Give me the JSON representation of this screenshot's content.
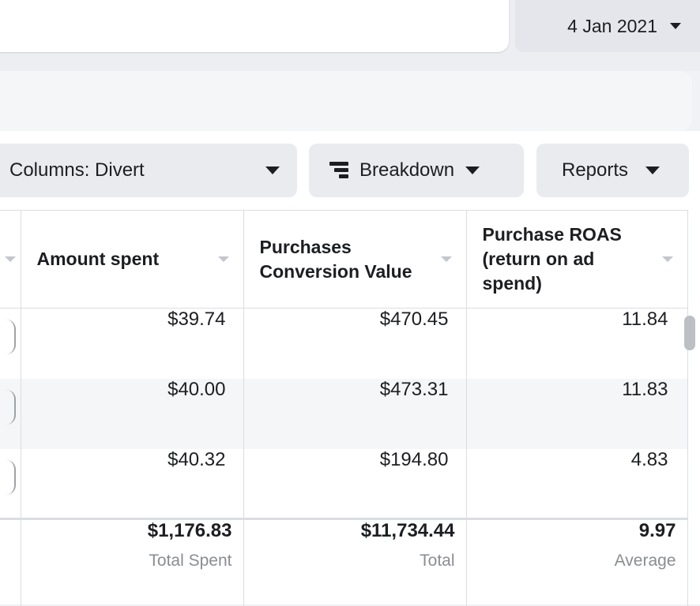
{
  "header": {
    "date_label": "4 Jan 2021"
  },
  "toolbar": {
    "columns_label": "Columns: Divert",
    "breakdown_label": "Breakdown",
    "reports_label": "Reports"
  },
  "table": {
    "columns": [
      "Amount spent",
      "Purchases Conversion Value",
      "Purchase ROAS (return on ad spend)"
    ],
    "rows": [
      [
        "$39.74",
        "$470.45",
        "11.84"
      ],
      [
        "$40.00",
        "$473.31",
        "11.83"
      ],
      [
        "$40.32",
        "$194.80",
        "4.83"
      ]
    ],
    "totals": {
      "amount_spent": "$1,176.83",
      "amount_spent_label": "Total Spent",
      "conversion_value": "$11,734.44",
      "conversion_value_label": "Total",
      "roas": "9.97",
      "roas_label": "Average"
    }
  },
  "icons": {
    "date_caret": "caret-down-icon",
    "breakdown": "breakdown-icon",
    "sort": "sort-caret-icon"
  }
}
